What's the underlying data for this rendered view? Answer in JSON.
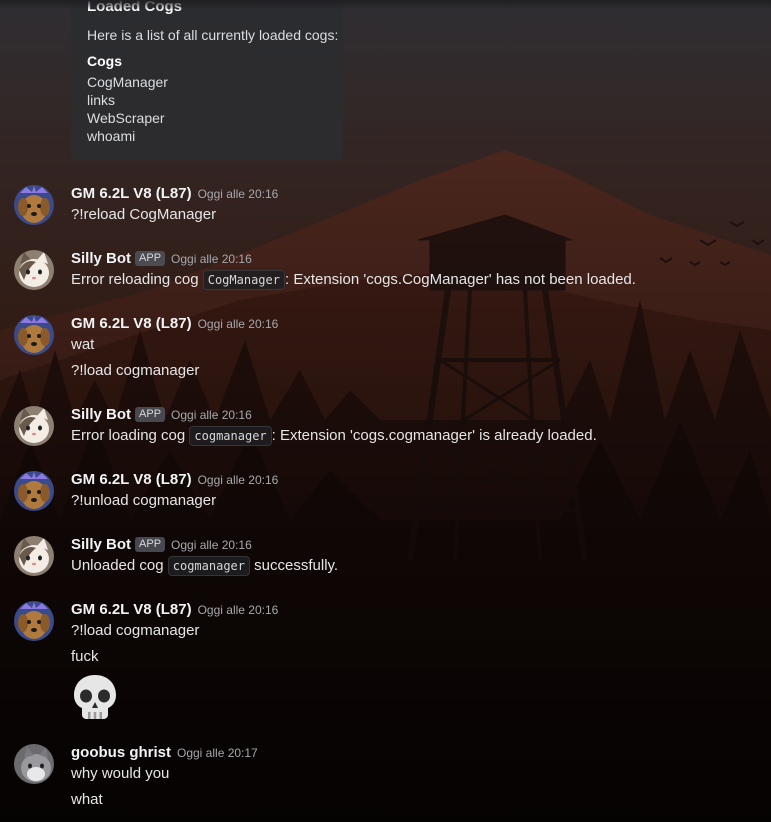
{
  "embed": {
    "title": "Loaded Cogs",
    "description": "Here is a list of all currently loaded cogs:",
    "field_name": "Cogs",
    "field_values": [
      "CogManager",
      "links",
      "WebScraper",
      "whoami"
    ]
  },
  "messages": [
    {
      "author": "GM 6.2L V8 (L87)",
      "time": "Oggi alle 20:16",
      "lines": [
        "?!reload CogManager"
      ]
    },
    {
      "author": "Silly Bot",
      "badge": "APP",
      "time": "Oggi alle 20:16",
      "lines": [
        {
          "before": "Error reloading cog ",
          "code": "CogManager",
          "after": ": Extension 'cogs.CogManager' has not been loaded."
        }
      ]
    },
    {
      "author": "GM 6.2L V8 (L87)",
      "time": "Oggi alle 20:16",
      "lines": [
        "wat",
        "?!load cogmanager"
      ]
    },
    {
      "author": "Silly Bot",
      "badge": "APP",
      "time": "Oggi alle 20:16",
      "lines": [
        {
          "before": "Error loading cog ",
          "code": "cogmanager",
          "after": ": Extension 'cogs.cogmanager' is already loaded."
        }
      ]
    },
    {
      "author": "GM 6.2L V8 (L87)",
      "time": "Oggi alle 20:16",
      "lines": [
        "?!unload cogmanager"
      ]
    },
    {
      "author": "Silly Bot",
      "badge": "APP",
      "time": "Oggi alle 20:16",
      "lines": [
        {
          "before": "Unloaded cog ",
          "code": "cogmanager",
          "after": " successfully."
        }
      ]
    },
    {
      "author": "GM 6.2L V8 (L87)",
      "time": "Oggi alle 20:16",
      "lines": [
        "?!load cogmanager",
        "fuck"
      ],
      "emoji": "skull-emoji"
    },
    {
      "author": "goobus ghrist",
      "time": "Oggi alle 20:17",
      "lines": [
        "why would you",
        "what"
      ]
    }
  ],
  "colors": {
    "embed_bg": "#2b2c30",
    "app_badge": "#4e5058",
    "username": "#f2f3f5",
    "timestamp": "#a6a8ad"
  }
}
